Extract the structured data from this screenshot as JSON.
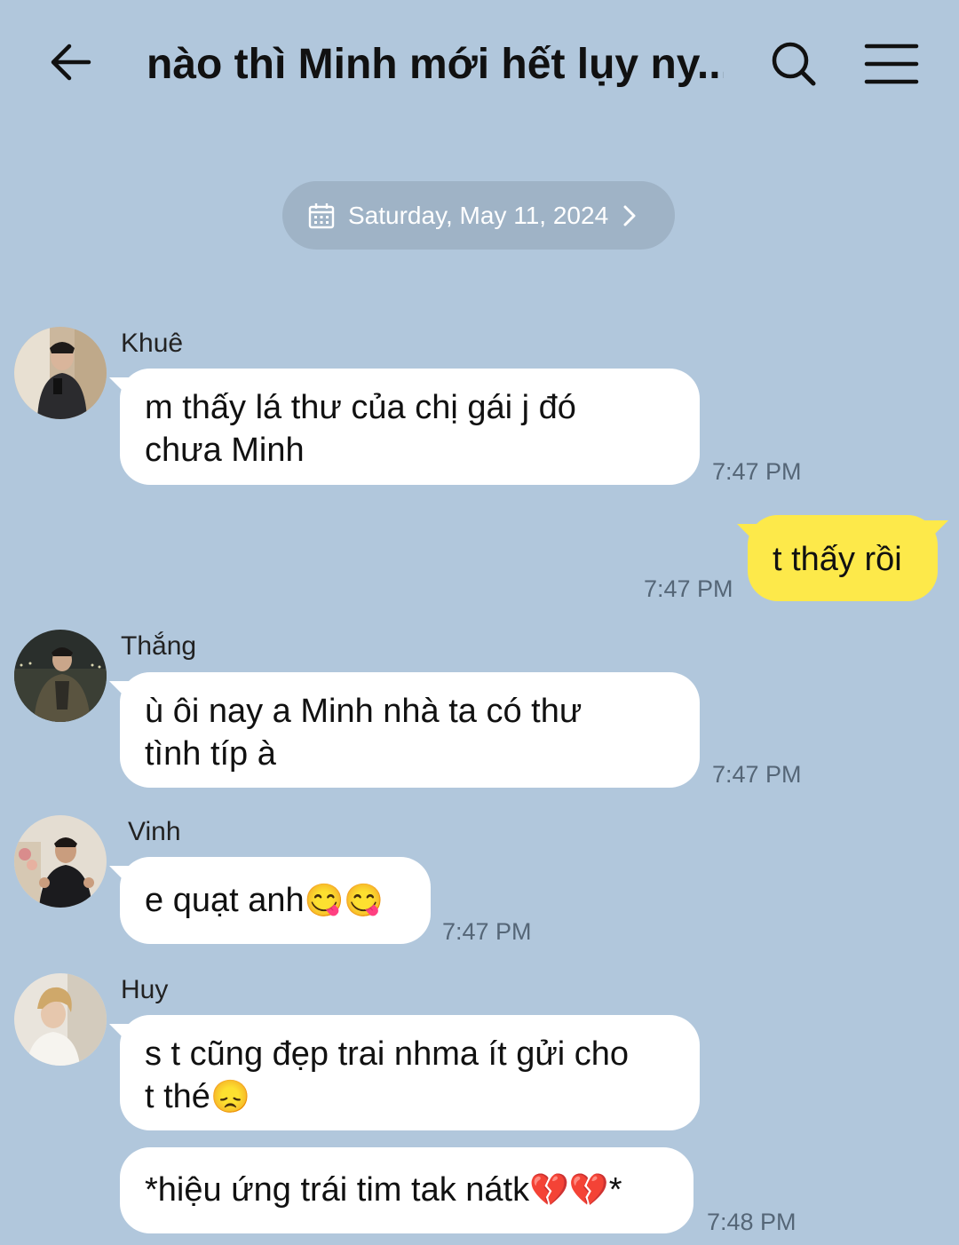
{
  "header": {
    "title": "nào thì Minh mới hết lụy ny...",
    "back_icon": "arrow-left-icon",
    "search_icon": "search-icon",
    "menu_icon": "hamburger-menu-icon"
  },
  "date_chip": {
    "label": "Saturday, May 11, 2024",
    "icon": "calendar-icon",
    "chevron": "chevron-right-icon"
  },
  "colors": {
    "background": "#b1c7dc",
    "my_bubble": "#fde94a",
    "their_bubble": "#ffffff",
    "date_chip": "#9fb3c6"
  },
  "messages": [
    {
      "sender": "Khuê",
      "line1": "m thấy lá thư của chị gái j đó",
      "line2": "chưa Minh",
      "time": "7:47 PM"
    },
    {
      "sender": "me",
      "line1": "t thấy rồi",
      "time": "7:47 PM"
    },
    {
      "sender": "Thắng",
      "line1": "ù ôi nay a Minh nhà ta có thư",
      "line2": "tình típ à",
      "time": "7:47 PM"
    },
    {
      "sender": "Vinh",
      "line1": "e quạt anh",
      "emoji": "😋😋",
      "time": "7:47 PM"
    },
    {
      "sender": "Huy",
      "line1": "s t cũng đẹp trai nhma ít gửi cho",
      "line2": "t thé",
      "emoji": "😞"
    },
    {
      "sender": "Huy",
      "line1": "*hiệu ứng trái tim tak nátk",
      "emoji": "💔💔",
      "line_end": "*",
      "time": "7:48 PM"
    }
  ]
}
